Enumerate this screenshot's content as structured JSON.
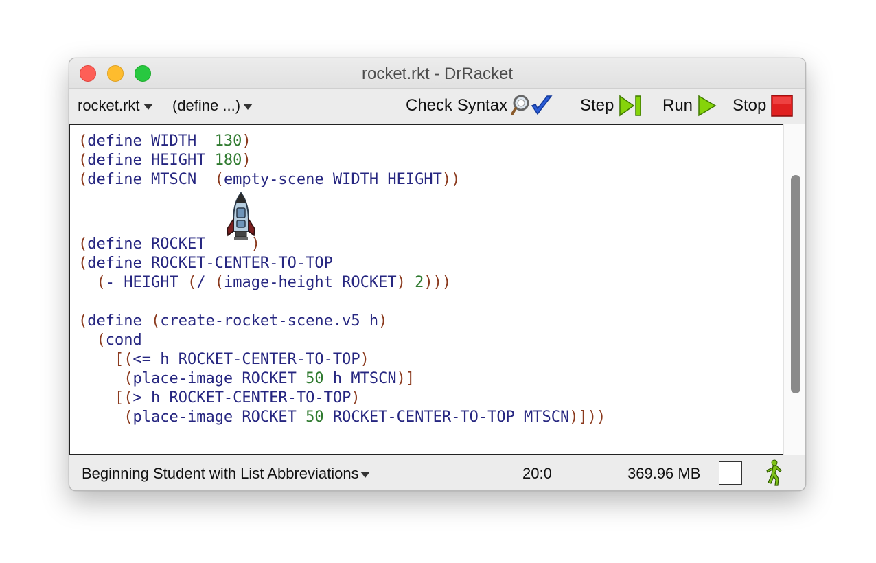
{
  "window": {
    "title": "rocket.rkt - DrRacket"
  },
  "toolbar": {
    "file_menu": "rocket.rkt",
    "define_menu": "(define ...)",
    "check_syntax": "Check Syntax",
    "step": "Step",
    "run": "Run",
    "stop": "Stop"
  },
  "code": {
    "lines": [
      "(define WIDTH  130)",
      "(define HEIGHT 180)",
      "(define MTSCN  (empty-scene WIDTH HEIGHT))",
      "",
      "",
      "(define ROCKET     )",
      "(define ROCKET-CENTER-TO-TOP",
      "  (- HEIGHT (/ (image-height ROCKET) 2)))",
      "",
      "(define (create-rocket-scene.v5 h)",
      "  (cond",
      "    [(<= h ROCKET-CENTER-TO-TOP)",
      "     (place-image ROCKET 50 h MTSCN)]",
      "    [(> h ROCKET-CENTER-TO-TOP)",
      "     (place-image ROCKET 50 ROCKET-CENTER-TO-TOP MTSCN)]))"
    ],
    "embedded_image": "rocket-icon"
  },
  "status": {
    "language": "Beginning Student with List Abbreviations",
    "position": "20:0",
    "memory": "369.96 MB"
  },
  "colors": {
    "paren": "#8b3a1e",
    "symbol": "#262680",
    "number": "#2f7a2f",
    "stop": "#e02020",
    "run": "#7fd000"
  }
}
